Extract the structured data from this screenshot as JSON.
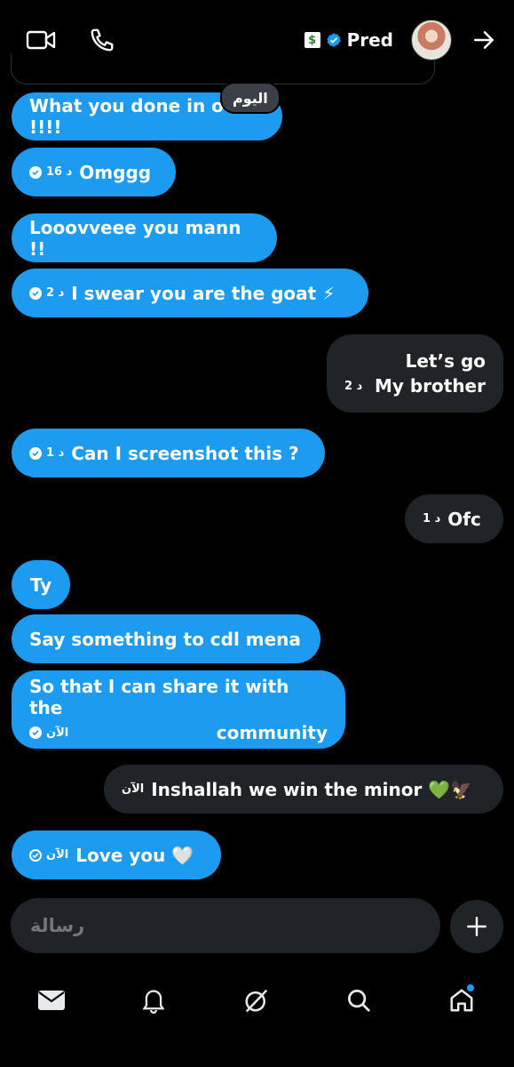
{
  "header": {
    "username": "Pred",
    "badge_money": "$",
    "icons": [
      "video-call-icon",
      "phone-icon",
      "verified-badge-icon",
      "arrow-right-icon"
    ]
  },
  "day_separator": "اليوم",
  "messages": [
    {
      "id": "m1",
      "direction": "in",
      "text": "What you done in od !!!!",
      "time": ""
    },
    {
      "id": "m2",
      "direction": "in",
      "text": "Omggg",
      "time": "16 د"
    },
    {
      "id": "m3",
      "direction": "in",
      "text": "Looovveee you mann !!",
      "time": ""
    },
    {
      "id": "m4",
      "direction": "in",
      "text": "I swear you are the goat ⚡",
      "time": "2 د"
    },
    {
      "id": "m5",
      "direction": "out",
      "line1": "Let’s go",
      "line2": "My brother",
      "time": "2 د"
    },
    {
      "id": "m6",
      "direction": "in",
      "text": "Can I screenshot this ?",
      "time": "1 د"
    },
    {
      "id": "m7",
      "direction": "out",
      "text": "Ofc",
      "time": "1 د"
    },
    {
      "id": "m8",
      "direction": "in",
      "text": "Ty",
      "time": ""
    },
    {
      "id": "m9",
      "direction": "in",
      "text": "Say something to cdl mena",
      "time": ""
    },
    {
      "id": "m10",
      "direction": "in",
      "line1": "So that I can share it with the",
      "line2": "community",
      "time": "الآن"
    },
    {
      "id": "m11",
      "direction": "out",
      "text": "Inshallah we win the minor 💚🦅",
      "time": "الآن"
    },
    {
      "id": "m12",
      "direction": "in",
      "text": "Love you 🤍",
      "time": "الآن"
    }
  ],
  "composer": {
    "placeholder": "رسالة"
  },
  "nav": [
    "mail-icon",
    "bell-icon",
    "grok-icon",
    "search-icon",
    "home-icon"
  ],
  "colors": {
    "incoming_bubble": "#1d9bf0",
    "outgoing_bubble": "#202327",
    "background": "#000000"
  }
}
